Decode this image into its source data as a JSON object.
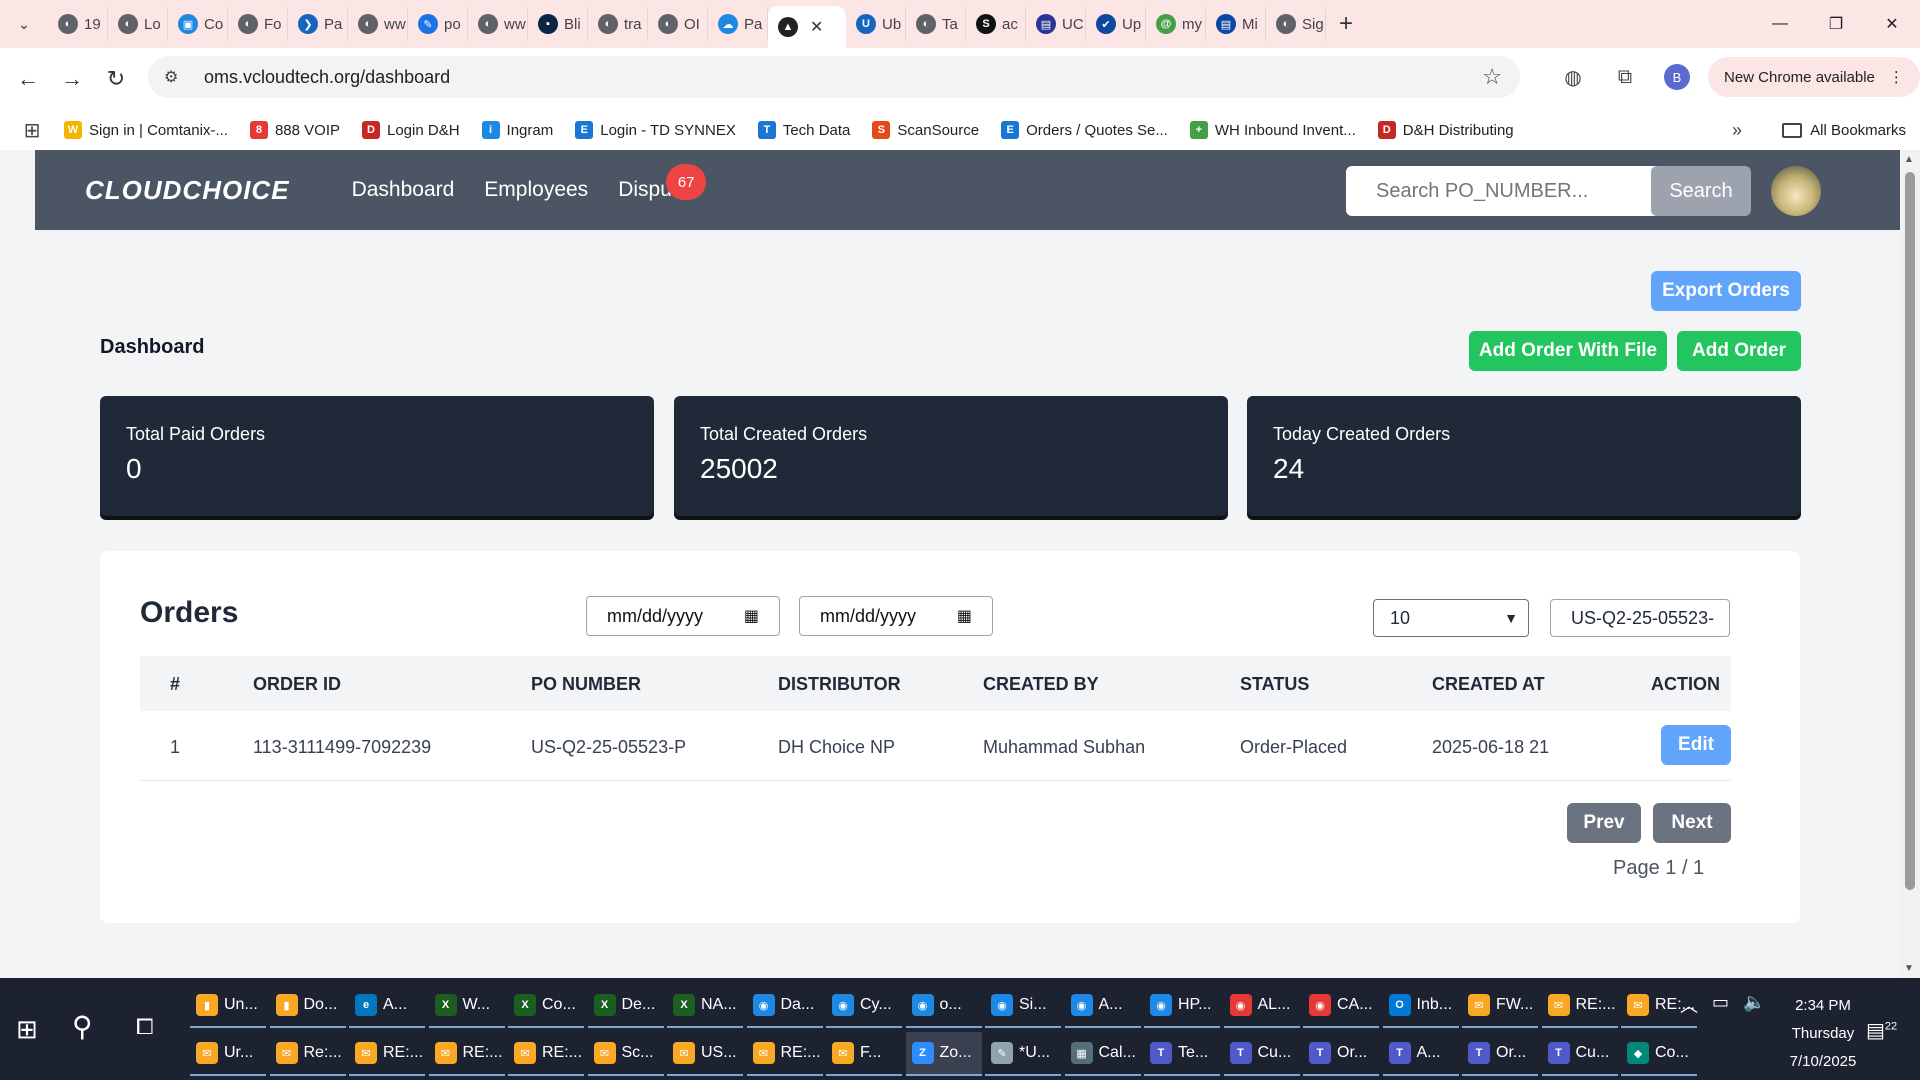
{
  "browser": {
    "tabs": [
      {
        "title": "19",
        "fav": "◐",
        "color": "#5f6368"
      },
      {
        "title": "Lo",
        "fav": "◐",
        "color": "#5f6368"
      },
      {
        "title": "Co",
        "fav": "▣",
        "color": "#1e88e5"
      },
      {
        "title": "Fo",
        "fav": "◐",
        "color": "#5f6368"
      },
      {
        "title": "Pa",
        "fav": "❯",
        "color": "#1565c0"
      },
      {
        "title": "ww",
        "fav": "◐",
        "color": "#5f6368"
      },
      {
        "title": "po",
        "fav": "✎",
        "color": "#1a73e8"
      },
      {
        "title": "ww",
        "fav": "◐",
        "color": "#5f6368"
      },
      {
        "title": "Bli",
        "fav": "▪",
        "color": "#0b2545"
      },
      {
        "title": "tra",
        "fav": "◐",
        "color": "#5f6368"
      },
      {
        "title": "OI",
        "fav": "◐",
        "color": "#5f6368"
      },
      {
        "title": "Pa",
        "fav": "☁",
        "color": "#1e88e5"
      }
    ],
    "active_tab_fav": "▲",
    "tabs_after": [
      {
        "title": "Ub",
        "fav": "U",
        "color": "#1565c0"
      },
      {
        "title": "Ta",
        "fav": "◐",
        "color": "#5f6368"
      },
      {
        "title": "ac",
        "fav": "S",
        "color": "#111111"
      },
      {
        "title": "UC",
        "fav": "▤",
        "color": "#283593"
      },
      {
        "title": "Up",
        "fav": "✔",
        "color": "#0d47a1"
      },
      {
        "title": "my",
        "fav": "@",
        "color": "#43a047"
      },
      {
        "title": "Mi",
        "fav": "▤",
        "color": "#0d47a1"
      },
      {
        "title": "Sig",
        "fav": "◐",
        "color": "#5f6368"
      }
    ],
    "url": "oms.vcloudtech.org/dashboard",
    "profile_initial": "B",
    "new_chrome_label": "New Chrome available",
    "bookmarks": [
      {
        "label": "Sign in | Comtanix-...",
        "icon": "W",
        "color": "#f4b400"
      },
      {
        "label": "888 VOIP",
        "icon": "8",
        "color": "#e53935"
      },
      {
        "label": "Login D&H",
        "icon": "D",
        "color": "#c62828"
      },
      {
        "label": "Ingram",
        "icon": "i",
        "color": "#1e88e5"
      },
      {
        "label": "Login - TD SYNNEX",
        "icon": "E",
        "color": "#1976d2"
      },
      {
        "label": "Tech Data",
        "icon": "T",
        "color": "#1976d2"
      },
      {
        "label": "ScanSource",
        "icon": "S",
        "color": "#e64a19"
      },
      {
        "label": "Orders / Quotes Se...",
        "icon": "E",
        "color": "#1976d2"
      },
      {
        "label": "WH Inbound Invent...",
        "icon": "+",
        "color": "#43a047"
      },
      {
        "label": "D&H Distributing",
        "icon": "D",
        "color": "#c62828"
      }
    ],
    "all_bookmarks_label": "All Bookmarks"
  },
  "app": {
    "logo": "CLOUDCHOICE",
    "nav": [
      {
        "label": "Dashboard"
      },
      {
        "label": "Employees"
      },
      {
        "label": "Dispu"
      }
    ],
    "dispute_badge": "67",
    "search_placeholder": "Search PO_NUMBER...",
    "search_button": "Search"
  },
  "dashboard": {
    "title": "Dashboard",
    "export_button": "Export Orders",
    "add_file_button": "Add Order With File",
    "add_button": "Add Order",
    "stats": [
      {
        "label": "Total Paid Orders",
        "value": "0"
      },
      {
        "label": "Total Created Orders",
        "value": "25002"
      },
      {
        "label": "Today Created Orders",
        "value": "24"
      }
    ]
  },
  "orders": {
    "title": "Orders",
    "date_from_placeholder": "mm/dd/yyyy",
    "date_to_placeholder": "mm/dd/yyyy",
    "page_size": "10",
    "po_filter_value": "US-Q2-25-05523-",
    "columns": [
      "#",
      "ORDER ID",
      "PO NUMBER",
      "DISTRIBUTOR",
      "CREATED BY",
      "STATUS",
      "CREATED AT",
      "ACTION"
    ],
    "rows": [
      {
        "index": "1",
        "order_id": "113-3111499-7092239",
        "po_number": "US-Q2-25-05523-P",
        "distributor": "DH Choice NP",
        "created_by": "Muhammad Subhan",
        "status": "Order-Placed",
        "created_at": "2025-06-18 21",
        "action": "Edit"
      }
    ],
    "prev_button": "Prev",
    "next_button": "Next",
    "page_info": "Page 1 / 1"
  },
  "taskbar": {
    "row1": [
      {
        "label": "Un...",
        "icon": "▮",
        "color": "#f9a825"
      },
      {
        "label": "Do...",
        "icon": "▮",
        "color": "#f9a825"
      },
      {
        "label": "A...",
        "icon": "e",
        "color": "#0277bd"
      },
      {
        "label": "W...",
        "icon": "X",
        "color": "#1b5e20"
      },
      {
        "label": "Co...",
        "icon": "X",
        "color": "#1b5e20"
      },
      {
        "label": "De...",
        "icon": "X",
        "color": "#1b5e20"
      },
      {
        "label": "NA...",
        "icon": "X",
        "color": "#1b5e20"
      },
      {
        "label": "Da...",
        "icon": "◉",
        "color": "#1e88e5"
      },
      {
        "label": "Cy...",
        "icon": "◉",
        "color": "#1e88e5"
      },
      {
        "label": "o...",
        "icon": "◉",
        "color": "#1e88e5"
      },
      {
        "label": "Si...",
        "icon": "◉",
        "color": "#1e88e5"
      },
      {
        "label": "A...",
        "icon": "◉",
        "color": "#1e88e5"
      },
      {
        "label": "HP...",
        "icon": "◉",
        "color": "#1e88e5"
      },
      {
        "label": "AL...",
        "icon": "◉",
        "color": "#e53935"
      },
      {
        "label": "CA...",
        "icon": "◉",
        "color": "#e53935"
      },
      {
        "label": "Inb...",
        "icon": "O",
        "color": "#0078d4"
      },
      {
        "label": "FW...",
        "icon": "✉",
        "color": "#f9a825"
      },
      {
        "label": "RE:...",
        "icon": "✉",
        "color": "#f9a825"
      },
      {
        "label": "RE:...",
        "icon": "✉",
        "color": "#f9a825"
      }
    ],
    "row2": [
      {
        "label": "Ur...",
        "icon": "✉",
        "color": "#f9a825"
      },
      {
        "label": "Re:...",
        "icon": "✉",
        "color": "#f9a825"
      },
      {
        "label": "RE:...",
        "icon": "✉",
        "color": "#f9a825"
      },
      {
        "label": "RE:...",
        "icon": "✉",
        "color": "#f9a825"
      },
      {
        "label": "RE:...",
        "icon": "✉",
        "color": "#f9a825"
      },
      {
        "label": "Sc...",
        "icon": "✉",
        "color": "#f9a825"
      },
      {
        "label": "US...",
        "icon": "✉",
        "color": "#f9a825"
      },
      {
        "label": "RE:...",
        "icon": "✉",
        "color": "#f9a825"
      },
      {
        "label": "F...",
        "icon": "✉",
        "color": "#f9a825"
      },
      {
        "label": "Zo...",
        "icon": "Z",
        "color": "#2d8cff"
      },
      {
        "label": "*U...",
        "icon": "✎",
        "color": "#90a4ae"
      },
      {
        "label": "Cal...",
        "icon": "▦",
        "color": "#546e7a"
      },
      {
        "label": "Te...",
        "icon": "T",
        "color": "#5059c9"
      },
      {
        "label": "Cu...",
        "icon": "T",
        "color": "#5059c9"
      },
      {
        "label": "Or...",
        "icon": "T",
        "color": "#5059c9"
      },
      {
        "label": "A...",
        "icon": "T",
        "color": "#5059c9"
      },
      {
        "label": "Or...",
        "icon": "T",
        "color": "#5059c9"
      },
      {
        "label": "Cu...",
        "icon": "T",
        "color": "#5059c9"
      },
      {
        "label": "Co...",
        "icon": "◆",
        "color": "#00897b"
      }
    ],
    "time": "2:34 PM",
    "day": "Thursday",
    "date": "7/10/2025",
    "notif_count": "22"
  }
}
